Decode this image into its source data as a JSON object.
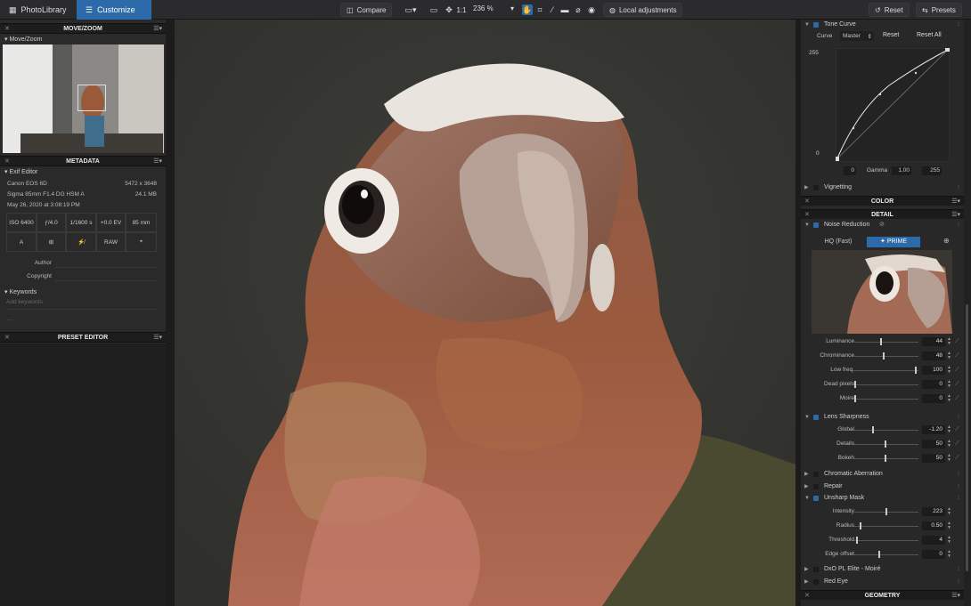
{
  "topbar": {
    "tab_library": "PhotoLibrary",
    "tab_customize": "Customize",
    "compare": "Compare",
    "one_to_one": "1:1",
    "zoom": "236 %",
    "local_adjustments": "Local adjustments",
    "reset": "Reset",
    "presets": "Presets"
  },
  "left": {
    "move_zoom_header": "MOVE/ZOOM",
    "move_zoom_sub": "Move/Zoom",
    "metadata_header": "METADATA",
    "exif_editor": "Exif Editor",
    "camera": "Canon EOS 6D",
    "resolution": "5472 x 3648",
    "lens": "Sigma 85mm F1.4 DG HSM A",
    "filesize": "24.1 MB",
    "date": "May 26, 2020 at 3:08:19 PM",
    "exif_cells": [
      "ISO 6400",
      "ƒ/4.0",
      "1/1600 s",
      "+0.0 EV",
      "85 mm"
    ],
    "exif_cells2": [
      "A",
      "",
      "",
      "RAW",
      ""
    ],
    "author_label": "Author",
    "copyright_label": "Copyright",
    "keywords": "Keywords",
    "keywords_placeholder": "Add keywords",
    "keywords_more": "....",
    "preset_editor_header": "PRESET EDITOR"
  },
  "right": {
    "tone_curve": "Tone Curve",
    "curve_label": "Curve",
    "curve_channel": "Master",
    "curve_reset": "Reset",
    "curve_reset_all": "Reset All",
    "curve_max": "255",
    "curve_min": "0",
    "in_min": "0",
    "gamma_label": "Gamma",
    "gamma": "1.00",
    "in_max": "255",
    "vignetting": "Vignetting",
    "color_header": "COLOR",
    "detail_header": "DETAIL",
    "noise_reduction": "Noise Reduction",
    "hq_fast": "HQ (Fast)",
    "prime": "PRIME",
    "nr_sliders": [
      {
        "label": "Luminance",
        "value": "44",
        "pos": 0.42
      },
      {
        "label": "Chrominance",
        "value": "48",
        "pos": 0.45
      },
      {
        "label": "Low freq.",
        "value": "100",
        "pos": 0.97
      },
      {
        "label": "Dead pixels",
        "value": "0",
        "pos": 0.0
      },
      {
        "label": "Moire",
        "value": "0",
        "pos": 0.0
      }
    ],
    "lens_sharpness": "Lens Sharpness",
    "ls_sliders": [
      {
        "label": "Global",
        "value": "-1.20",
        "pos": 0.28
      },
      {
        "label": "Details",
        "value": "50",
        "pos": 0.48
      },
      {
        "label": "Bokeh",
        "value": "50",
        "pos": 0.48
      }
    ],
    "chromatic_aberration": "Chromatic Aberration",
    "repair": "Repair",
    "unsharp_mask": "Unsharp Mask",
    "um_sliders": [
      {
        "label": "Intensity",
        "value": "223",
        "pos": 0.5
      },
      {
        "label": "Radius",
        "value": "0.50",
        "pos": 0.08
      },
      {
        "label": "Threshold",
        "value": "4",
        "pos": 0.03
      },
      {
        "label": "Edge offset",
        "value": "0",
        "pos": 0.38
      }
    ],
    "moire_elite": "DxO PL Elite - Moiré",
    "red_eye": "Red Eye",
    "geometry_header": "GEOMETRY"
  }
}
